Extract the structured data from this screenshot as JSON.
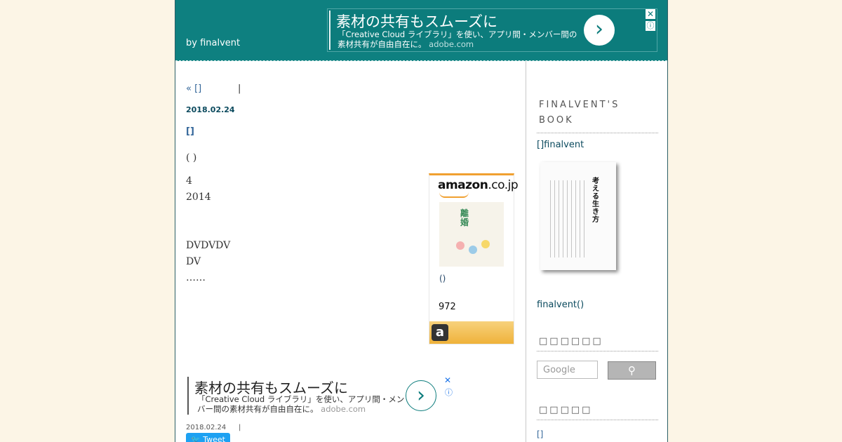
{
  "header": {
    "byline": "by finalvent",
    "ad": {
      "title": "素材の共有もスムーズに",
      "desc": "「Creative Cloud ライブラリ」を使い、アプリ間・メンバー間の素材共有が自由自在に。",
      "domain": "adobe.com",
      "arrow": "›",
      "close": "✕",
      "info": "ⓘ"
    }
  },
  "post": {
    "nav_prev": "« []",
    "nav_sep": "|",
    "date": "2018.02.24",
    "title": "[]",
    "body": [
      "(                    )",
      "4",
      "2014",
      "",
      "DVDVDV",
      "DV",
      "……"
    ]
  },
  "amazon_widget": {
    "logo": "amazon",
    "logo_suffix": ".co.jp",
    "cover_text": "離婚",
    "caption": "()",
    "price": "972",
    "footer_icon": "a",
    "accent_color": "#f0a030"
  },
  "ad_bottom": {
    "title": "素材の共有もスムーズに",
    "desc": "「Creative Cloud ライブラリ」を使い、アプリ間・メンバー間の素材共有が自由自在に。",
    "domain": "adobe.com",
    "arrow": "›",
    "close": "✕",
    "info": "ⓘ"
  },
  "post_footer": {
    "date": "2018.02.24",
    "sep": "|",
    "tweet_label": "Tweet"
  },
  "sidebar": {
    "book_heading": "FINALVENT'S BOOK",
    "book_link": "[]finalvent",
    "book_cover_title": "考える生き方",
    "author_link": "finalvent()",
    "search_heading": "□□□□□□",
    "search_placeholder": "Google",
    "search_icon": "search-icon",
    "recent_heading": "□□□□□",
    "recent_item": "[]"
  },
  "colors": {
    "header_bg": "#0e8080",
    "page_bg": "#fcf5e6",
    "link": "#336699"
  }
}
